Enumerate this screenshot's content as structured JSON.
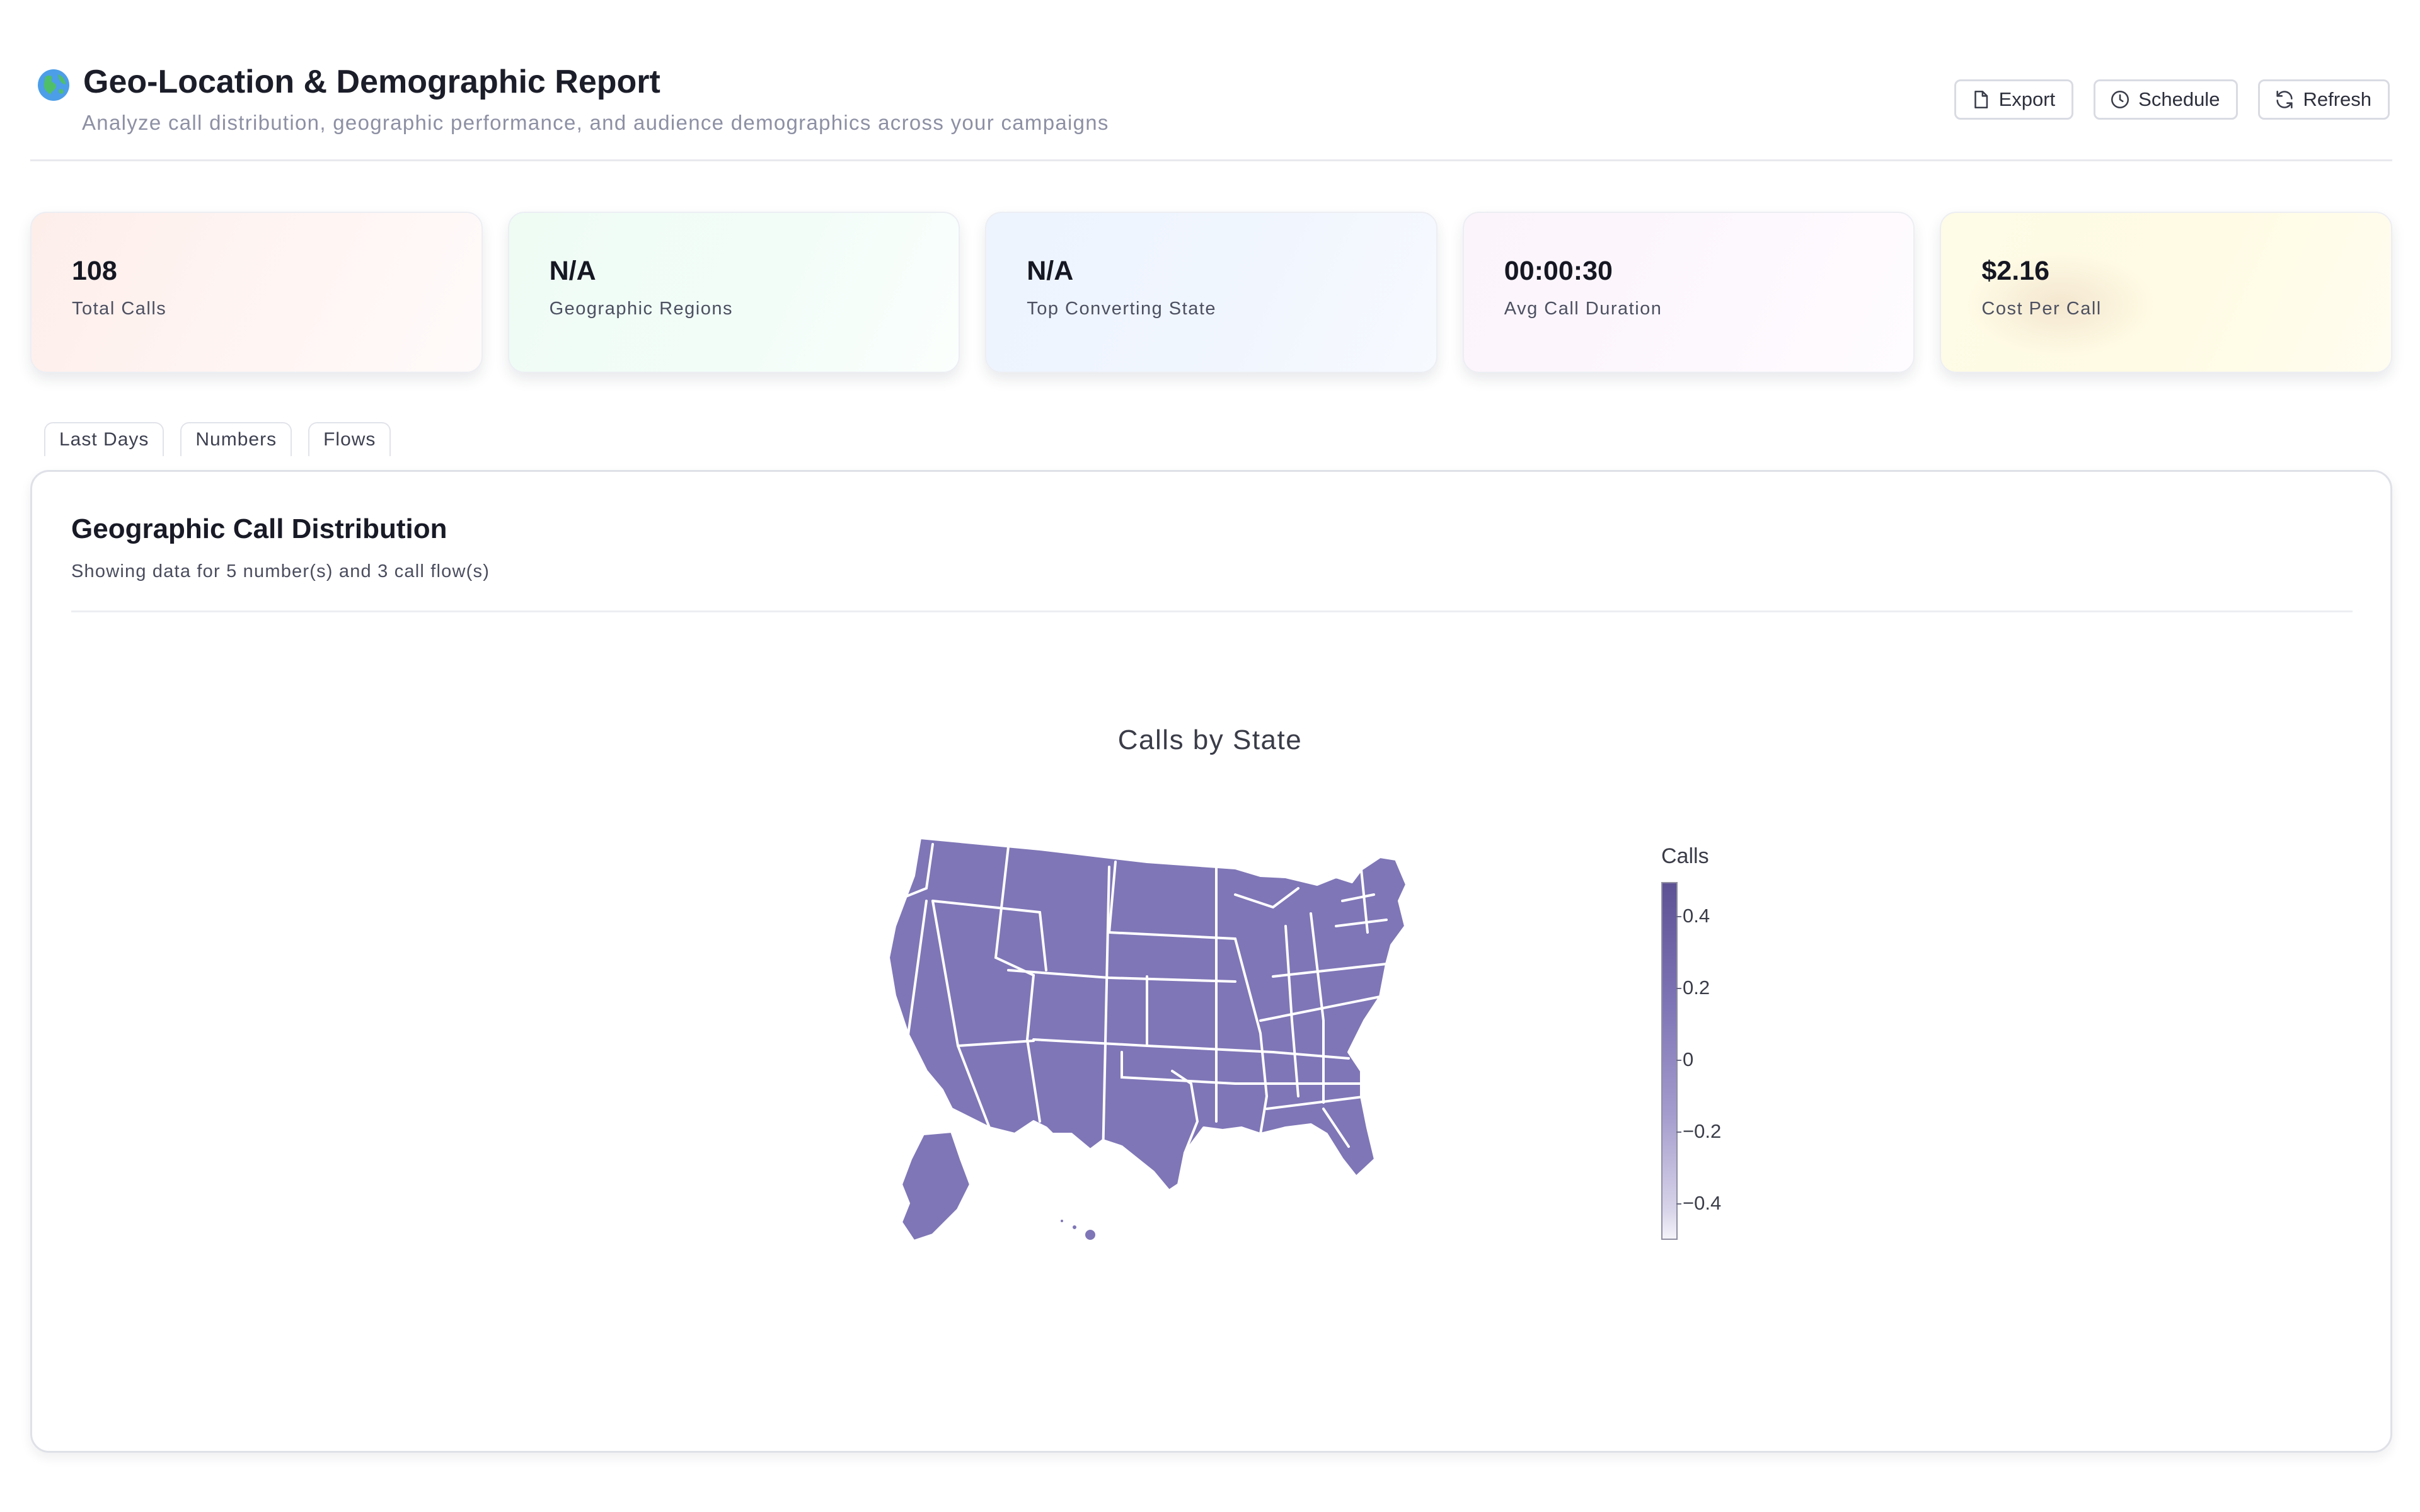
{
  "header": {
    "title": "Geo-Location & Demographic Report",
    "subtitle": "Analyze call distribution, geographic performance, and audience demographics across your campaigns",
    "globe_icon": "globe-icon"
  },
  "actions": {
    "export_label": "Export",
    "schedule_label": "Schedule",
    "refresh_label": "Refresh"
  },
  "kpis": [
    {
      "value": "108",
      "label": "Total Calls"
    },
    {
      "value": "N/A",
      "label": "Geographic Regions"
    },
    {
      "value": "N/A",
      "label": "Top Converting State"
    },
    {
      "value": "00:00:30",
      "label": "Avg Call Duration"
    },
    {
      "value": "$2.16",
      "label": "Cost Per Call"
    }
  ],
  "filters": [
    "Last Days",
    "Numbers",
    "Flows"
  ],
  "panel": {
    "title": "Geographic Call Distribution",
    "subtitle": "Showing data for 5 number(s) and 3 call flow(s)"
  },
  "chart_data": {
    "type": "choropleth",
    "title": "Calls by State",
    "region": "USA states",
    "colorbar_title": "Calls",
    "colorbar_ticks": [
      0.4,
      0.2,
      0,
      -0.2,
      -0.4
    ],
    "colorbar_tick_labels": [
      "0.4",
      "0.2",
      "0",
      "−0.2",
      "−0.4"
    ],
    "colorbar_range": [
      -0.5,
      0.5
    ],
    "fill_color": "#7f76b7",
    "values": "all states shown at the same mid value (no variation)"
  },
  "colors": {
    "accent": "#7f76b7",
    "border": "#dfe1e8"
  }
}
